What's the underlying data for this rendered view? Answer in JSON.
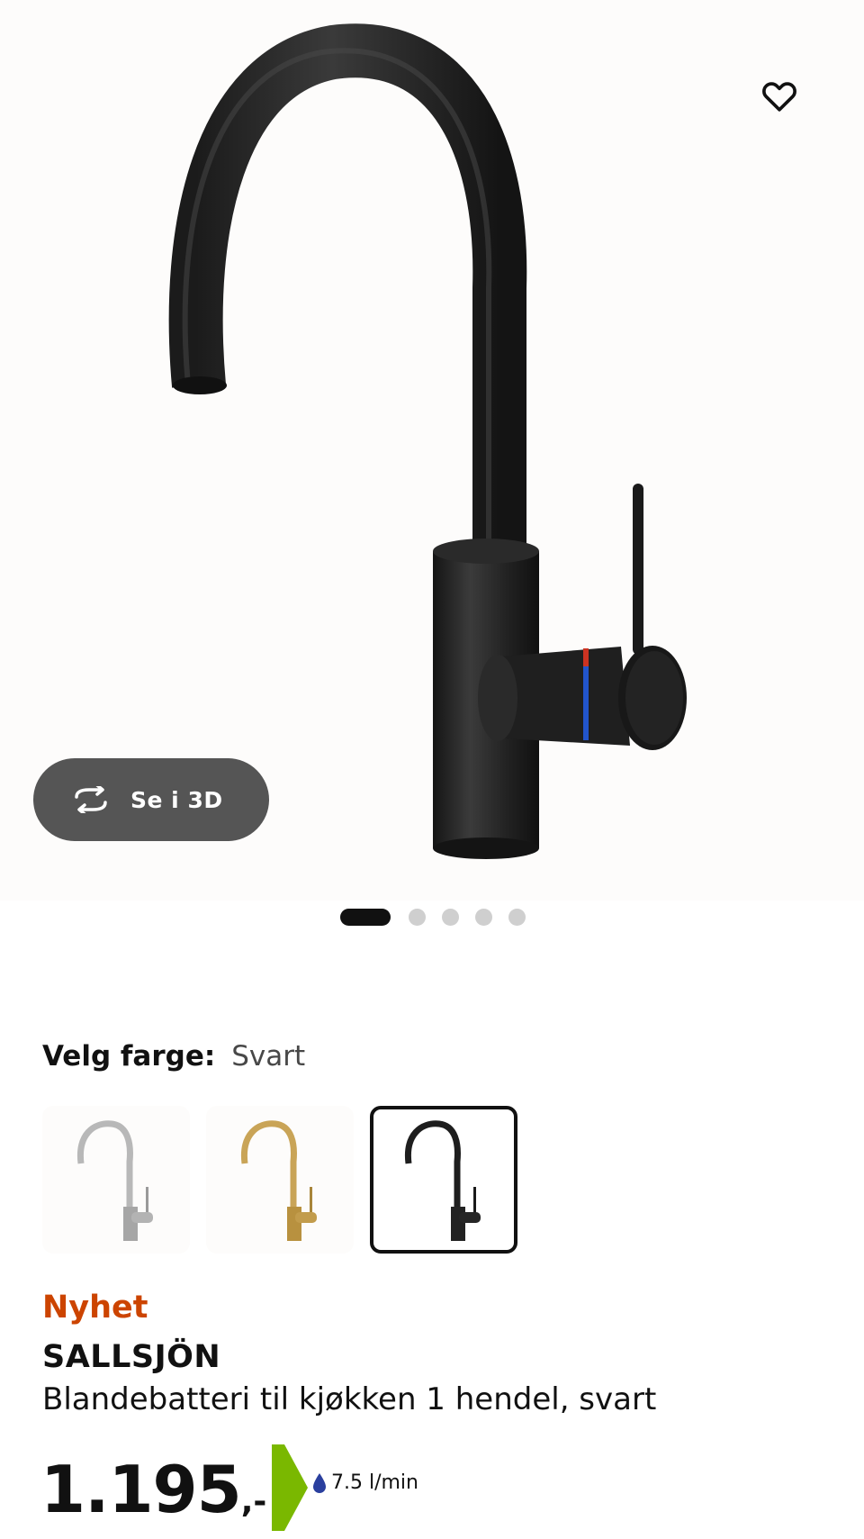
{
  "gallery": {
    "view_3d_label": "Se i 3D",
    "slide_count": 5,
    "active_slide": 1
  },
  "color_picker": {
    "label": "Velg farge:",
    "selected_value": "Svart",
    "options": [
      {
        "name": "stainless-steel",
        "color": "#b8b8b8"
      },
      {
        "name": "brass",
        "color": "#c9a457"
      },
      {
        "name": "black",
        "color": "#1e1e1e"
      }
    ]
  },
  "product": {
    "badge": "Nyhet",
    "name": "SALLSJÖN",
    "description": "Blandebatteri til kjøkken 1 hendel, svart",
    "price_main": "1.195",
    "price_suffix": ",-",
    "flow_rate": "7.5 l/min"
  },
  "colors": {
    "accent_new": "#cc4400",
    "energy_green": "#7ab800",
    "drop_blue": "#2a3f9e"
  }
}
